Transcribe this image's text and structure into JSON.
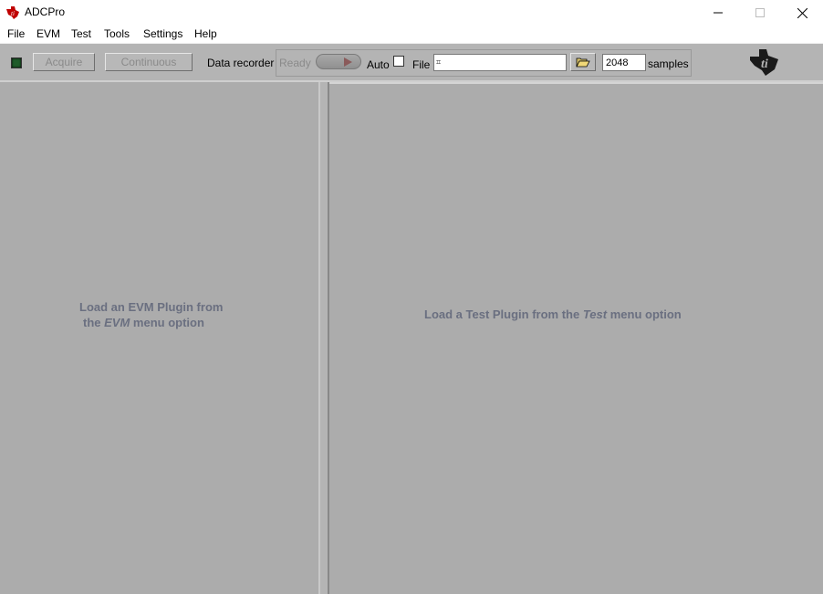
{
  "window": {
    "title": "ADCPro",
    "minimize_glyph": "—",
    "maximize_glyph": "☐",
    "close_glyph": "✕"
  },
  "menu": [
    {
      "label": "File"
    },
    {
      "label": "EVM"
    },
    {
      "label": "Test"
    },
    {
      "label": "Tools"
    },
    {
      "label": "Settings"
    },
    {
      "label": "Help"
    }
  ],
  "toolbar": {
    "acquire_label": "Acquire",
    "continuous_label": "Continuous",
    "data_recorder_label": "Data recorder",
    "ready_status": "Ready",
    "auto_label": "Auto",
    "file_label": "File",
    "file_path": "",
    "samples_value": "2048",
    "samples_label": "samples"
  },
  "left_panel": {
    "line1": "Load an EVM Plugin from",
    "line2_prefix": "the",
    "line2_emph": "EVM",
    "line2_suffix": "menu option"
  },
  "right_panel": {
    "prefix": "Load a Test Plugin from the",
    "emph": "Test",
    "suffix": "menu option"
  },
  "icons": {
    "app": "ti-logo-icon",
    "brand": "texas-instruments-logo",
    "folder": "folder-open-icon",
    "led": "status-led-icon"
  },
  "colors": {
    "panel_bg": "#acacac",
    "hint_text": "#6a6f80",
    "led": "#1f5c2a"
  }
}
